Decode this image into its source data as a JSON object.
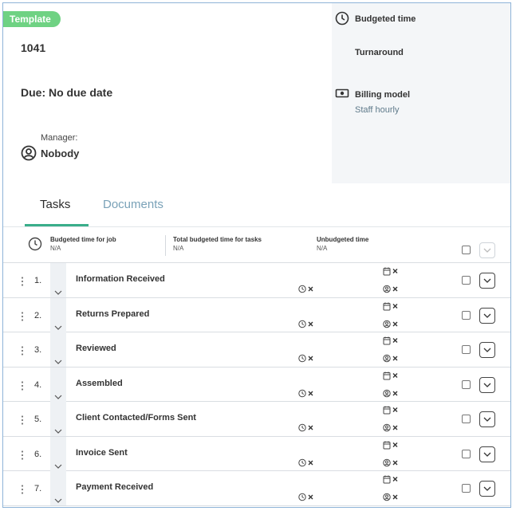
{
  "header": {
    "badge": "Template",
    "job_number": "1041",
    "due": "Due:  No due date",
    "manager_label": "Manager:",
    "manager_name": "Nobody",
    "budgeted_time_title": "Budgeted time",
    "turnaround_title": "Turnaround",
    "billing_model_title": "Billing model",
    "billing_model_value": "Staff hourly"
  },
  "tabs": {
    "tasks": "Tasks",
    "documents": "Documents"
  },
  "summary": {
    "budgeted_job_label": "Budgeted time for job",
    "budgeted_job_value": "N/A",
    "total_tasks_label": "Total budgeted time for tasks",
    "total_tasks_value": "N/A",
    "unbudgeted_label": "Unbudgeted time",
    "unbudgeted_value": "N/A"
  },
  "tasks": [
    {
      "num": "1.",
      "title": "Information Received"
    },
    {
      "num": "2.",
      "title": "Returns Prepared"
    },
    {
      "num": "3.",
      "title": "Reviewed"
    },
    {
      "num": "4.",
      "title": "Assembled"
    },
    {
      "num": "5.",
      "title": "Client Contacted/Forms Sent"
    },
    {
      "num": "6.",
      "title": "Invoice Sent"
    },
    {
      "num": "7.",
      "title": "Payment Received"
    }
  ],
  "colors": {
    "badge": "#6fd283",
    "tab_active_underline": "#3aae8a",
    "tab_inactive": "#7aa2b8",
    "panel_bg": "#f4f6f8"
  }
}
